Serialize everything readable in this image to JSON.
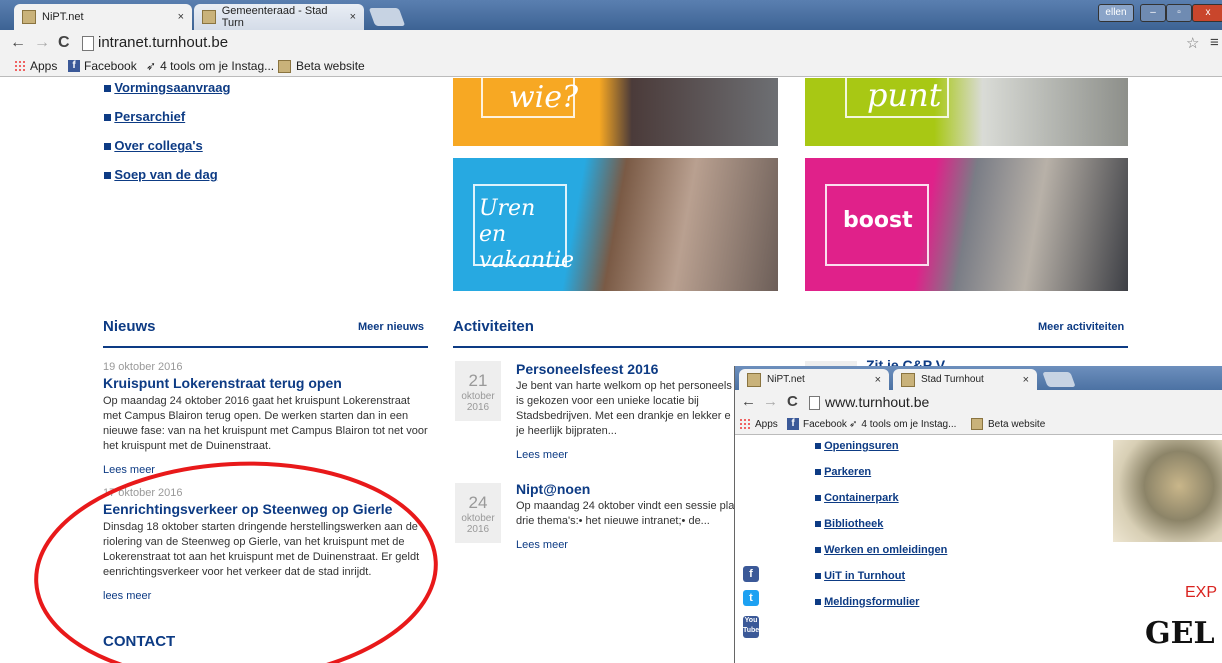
{
  "browser": {
    "tabs": [
      {
        "title": "NiPT.net",
        "close": "×"
      },
      {
        "title": "Gemeenteraad - Stad Turn",
        "close": "×"
      }
    ],
    "user_badge": "ellen",
    "url": "intranet.turnhout.be",
    "bookmarks": [
      "Apps",
      "Facebook",
      "4 tools om je Instag...",
      "Beta website"
    ]
  },
  "sidebar": {
    "links": [
      "Vormingsaanvraag",
      "Persarchief",
      "Over collega's",
      "Soep van de dag"
    ]
  },
  "tiles": [
    {
      "label": "wie?",
      "color": "#f7a823"
    },
    {
      "label": "punt",
      "color": "#a8c814"
    },
    {
      "label": "Uren en vakantie",
      "color": "#27a9e1"
    },
    {
      "label": "boost",
      "color": "#e0218a"
    }
  ],
  "nieuws": {
    "heading": "Nieuws",
    "more": "Meer nieuws",
    "items": [
      {
        "date": "19 oktober 2016",
        "title": "Kruispunt Lokerenstraat terug open",
        "lines": [
          "Op maandag 24 oktober 2016 gaat het kruispunt Lokerenstraat",
          "met Campus Blairon terug open. De werken starten dan in een",
          "nieuwe fase: van na het kruispunt met Campus Blairon tot net voor",
          "het kruispunt met de Duinenstraat."
        ],
        "more": "Lees meer"
      },
      {
        "date": "17 oktober 2016",
        "title": "Eenrichtingsverkeer op Steenweg op Gierle",
        "lines": [
          "Dinsdag 18 oktober starten dringende herstellingswerken aan de",
          "riolering van de Steenweg op Gierle, van het kruispunt met de",
          "Lokerenstraat tot aan het kruispunt met de Duinenstraat. Er geldt",
          "eenrichtingsverkeer voor het verkeer dat de stad inrijdt."
        ],
        "more": "lees meer"
      }
    ]
  },
  "contact": {
    "heading": "CONTACT"
  },
  "activiteiten": {
    "heading": "Activiteiten",
    "more": "Meer activiteiten",
    "items": [
      {
        "day": "21",
        "month": "oktober",
        "year": "2016",
        "title": "Personeelsfeest 2016",
        "lines": [
          "Je bent van harte welkom op het personeels",
          "is gekozen voor een unieke locatie bij",
          "Stadsbedrijven.  Met een drankje en lekker e",
          "je heerlijk bijpraten..."
        ],
        "more": "Lees meer"
      },
      {
        "day": "24",
        "month": "oktober",
        "year": "2016",
        "title": "Nipt@noen",
        "lines": [
          "Op maandag 24 oktober vindt een sessie pla",
          "drie thema's:•   het nieuwe intranet;•   de..."
        ],
        "more": "Lees meer"
      }
    ],
    "partial_title": "Zit je C&P V"
  },
  "overlay": {
    "tabs": [
      {
        "title": "NiPT.net",
        "close": "×"
      },
      {
        "title": "Stad Turnhout",
        "close": "×"
      }
    ],
    "url": "www.turnhout.be",
    "bookmarks": [
      "Apps",
      "Facebook",
      "4 tools om je Instag...",
      "Beta website"
    ],
    "links": [
      "Openingsuren",
      "Parkeren",
      "Containerpark",
      "Bibliotheek",
      "Werken en omleidingen",
      "UiT in Turnhout",
      "Meldingsformulier"
    ],
    "social": [
      "f",
      "t",
      "You Tube"
    ],
    "text_red": "EXP",
    "text_big": "GEL"
  },
  "colors": {
    "navy": "#0d3b84",
    "annotation_red": "#e8191a"
  }
}
